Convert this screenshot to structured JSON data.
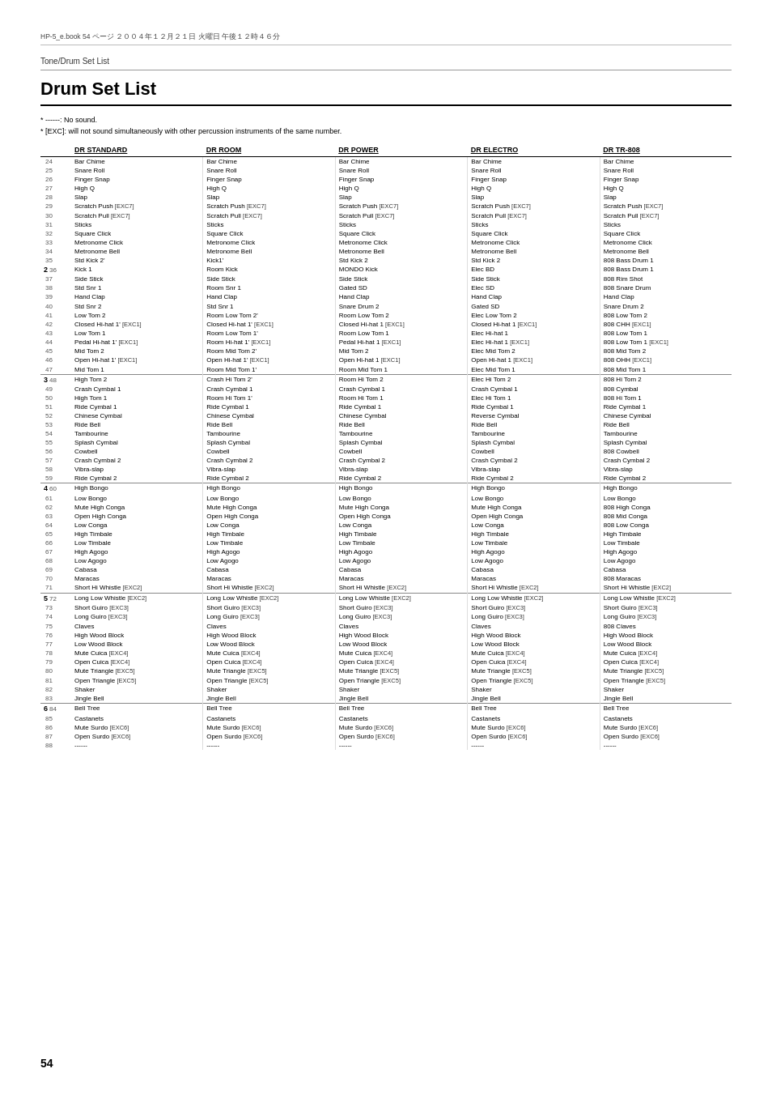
{
  "header": {
    "breadcrumb": "Tone/Drum Set List",
    "title": "Drum Set List",
    "page_info": "HP-5_e.book  54 ページ  ２００４年１２月２１日  火曜日  午後１２時４６分"
  },
  "notes": [
    "* ------: No sound.",
    "* [EXC]: will not sound simultaneously with other percussion instruments of the same number."
  ],
  "columns": [
    "DR STANDARD",
    "DR ROOM",
    "DR POWER",
    "DR ELECTRO",
    "DR TR-808"
  ],
  "page_number": "54",
  "groups": [
    {
      "group": "",
      "items": [
        {
          "num": "24",
          "group_num": "",
          "names": [
            "Bar Chime",
            "Bar Chime",
            "Bar Chime",
            "Bar Chime",
            "Bar Chime"
          ]
        },
        {
          "num": "25",
          "group_num": "",
          "names": [
            "Snare Roll",
            "Snare Roll",
            "Snare Roll",
            "Snare Roll",
            "Snare Roll"
          ]
        },
        {
          "num": "26",
          "group_num": "",
          "names": [
            "Finger Snap",
            "Finger Snap",
            "Finger Snap",
            "Finger Snap",
            "Finger Snap"
          ]
        },
        {
          "num": "27",
          "group_num": "",
          "names": [
            "High Q",
            "High Q",
            "High Q",
            "High Q",
            "High Q"
          ]
        },
        {
          "num": "28",
          "group_num": "",
          "names": [
            "Slap",
            "Slap",
            "Slap",
            "Slap",
            "Slap"
          ]
        },
        {
          "num": "29",
          "group_num": "",
          "names": [
            "Scratch Push [EXC7]",
            "Scratch Push [EXC7]",
            "Scratch Push [EXC7]",
            "Scratch Push [EXC7]",
            "Scratch Push [EXC7]"
          ]
        },
        {
          "num": "30",
          "group_num": "",
          "names": [
            "Scratch Pull [EXC7]",
            "Scratch Pull [EXC7]",
            "Scratch Pull [EXC7]",
            "Scratch Pull [EXC7]",
            "Scratch Pull [EXC7]"
          ]
        },
        {
          "num": "31",
          "group_num": "",
          "names": [
            "Sticks",
            "Sticks",
            "Sticks",
            "Sticks",
            "Sticks"
          ]
        },
        {
          "num": "32",
          "group_num": "",
          "names": [
            "Square Click",
            "Square Click",
            "Square Click",
            "Square Click",
            "Square Click"
          ]
        },
        {
          "num": "33",
          "group_num": "",
          "names": [
            "Metronome Click",
            "Metronome Click",
            "Metronome Click",
            "Metronome Click",
            "Metronome Click"
          ]
        },
        {
          "num": "34",
          "group_num": "",
          "names": [
            "Metronome Bell",
            "Metronome Bell",
            "Metronome Bell",
            "Metronome Bell",
            "Metronome Bell"
          ]
        },
        {
          "num": "35",
          "group_num": "",
          "names": [
            "Std Kick 2'",
            "Kick1'",
            "Std Kick 2",
            "Std Kick 2",
            "808 Bass Drum 1"
          ]
        },
        {
          "num": "36",
          "group_num": "2",
          "names": [
            "Kick 1",
            "Room Kick",
            "MONDO Kick",
            "Elec BD",
            "808 Bass Drum 1"
          ]
        },
        {
          "num": "37",
          "group_num": "",
          "names": [
            "Side Stick",
            "Side Stick",
            "Side Stick",
            "Side Stick",
            "808 Rim Shot"
          ]
        },
        {
          "num": "38",
          "group_num": "",
          "names": [
            "Std Snr 1",
            "Room Snr 1",
            "Gated SD",
            "Elec SD",
            "808 Snare Drum"
          ]
        },
        {
          "num": "39",
          "group_num": "",
          "names": [
            "Hand Clap",
            "Hand Clap",
            "Hand Clap",
            "Hand Clap",
            "Hand Clap"
          ]
        },
        {
          "num": "40",
          "group_num": "",
          "names": [
            "Std Snr 2",
            "Std Snr 1",
            "Snare Drum 2",
            "Gated SD",
            "Snare Drum 2"
          ]
        },
        {
          "num": "41",
          "group_num": "",
          "names": [
            "Low Tom 2",
            "Room Low Tom 2'",
            "Room Low Tom 2",
            "Elec Low Tom 2",
            "808 Low Tom 2"
          ]
        },
        {
          "num": "42",
          "group_num": "",
          "names": [
            "Closed Hi-hat 1' [EXC1]",
            "Closed Hi-hat 1' [EXC1]",
            "Closed Hi-hat 1 [EXC1]",
            "Closed Hi-hat 1 [EXC1]",
            "808 CHH [EXC1]"
          ]
        },
        {
          "num": "43",
          "group_num": "",
          "names": [
            "Low Tom 1",
            "Room Low Tom 1'",
            "Room Low Tom 1",
            "Elec Hi-hat 1",
            "808 Low Tom 1"
          ]
        },
        {
          "num": "44",
          "group_num": "",
          "names": [
            "Pedal Hi-hat 1' [EXC1]",
            "Room Hi-hat 1' [EXC1]",
            "Pedal Hi-hat 1 [EXC1]",
            "Elec Hi-hat 1 [EXC1]",
            "808 Low Tom 1 [EXC1]"
          ]
        },
        {
          "num": "45",
          "group_num": "",
          "names": [
            "Mid Tom 2",
            "Room Mid Tom 2'",
            "Mid Tom 2",
            "Elec Mid Tom 2",
            "808 Mid Tom 2"
          ]
        },
        {
          "num": "46",
          "group_num": "",
          "names": [
            "Open Hi-hat 1' [EXC1]",
            "Open Hi-hat 1' [EXC1]",
            "Open Hi-hat 1 [EXC1]",
            "Open Hi-hat 1 [EXC1]",
            "808 OHH [EXC1]"
          ]
        },
        {
          "num": "47",
          "group_num": "",
          "names": [
            "Mid Tom 1",
            "Room Mid Tom 1'",
            "Room Mid Tom 1",
            "Elec Mid Tom 1",
            "808 Mid Tom 1"
          ]
        }
      ]
    },
    {
      "group": "3",
      "items": [
        {
          "num": "48",
          "group_num": "3",
          "names": [
            "High Tom 2",
            "Crash Hi Tom 2'",
            "Room Hi Tom 2",
            "Elec Hi Tom 2",
            "808 Hi Tom 2"
          ]
        },
        {
          "num": "49",
          "group_num": "",
          "names": [
            "Crash Cymbal 1",
            "Crash Cymbal 1",
            "Crash Cymbal 1",
            "Crash Cymbal 1",
            "808 Cymbal"
          ]
        },
        {
          "num": "50",
          "group_num": "",
          "names": [
            "High Tom 1",
            "Room Hi Tom 1'",
            "Room Hi Tom 1",
            "Elec Hi Tom 1",
            "808 Hi Tom 1"
          ]
        },
        {
          "num": "51",
          "group_num": "",
          "names": [
            "Ride Cymbal 1",
            "Ride Cymbal 1",
            "Ride Cymbal 1",
            "Ride Cymbal 1",
            "Ride Cymbal 1"
          ]
        },
        {
          "num": "52",
          "group_num": "",
          "names": [
            "Chinese Cymbal",
            "Chinese Cymbal",
            "Chinese Cymbal",
            "Reverse Cymbal",
            "Chinese Cymbal"
          ]
        },
        {
          "num": "53",
          "group_num": "",
          "names": [
            "Ride Bell",
            "Ride Bell",
            "Ride Bell",
            "Ride Bell",
            "Ride Bell"
          ]
        },
        {
          "num": "54",
          "group_num": "",
          "names": [
            "Tambourine",
            "Tambourine",
            "Tambourine",
            "Tambourine",
            "Tambourine"
          ]
        },
        {
          "num": "55",
          "group_num": "",
          "names": [
            "Splash Cymbal",
            "Splash Cymbal",
            "Splash Cymbal",
            "Splash Cymbal",
            "Splash Cymbal"
          ]
        },
        {
          "num": "56",
          "group_num": "",
          "names": [
            "Cowbell",
            "Cowbell",
            "Cowbell",
            "Cowbell",
            "808 Cowbell"
          ]
        },
        {
          "num": "57",
          "group_num": "",
          "names": [
            "Crash Cymbal 2",
            "Crash Cymbal 2",
            "Crash Cymbal 2",
            "Crash Cymbal 2",
            "Crash Cymbal 2"
          ]
        },
        {
          "num": "58",
          "group_num": "",
          "names": [
            "Vibra-slap",
            "Vibra-slap",
            "Vibra-slap",
            "Vibra-slap",
            "Vibra-slap"
          ]
        },
        {
          "num": "59",
          "group_num": "",
          "names": [
            "Ride Cymbal 2",
            "Ride Cymbal 2",
            "Ride Cymbal 2",
            "Ride Cymbal 2",
            "Ride Cymbal 2"
          ]
        }
      ]
    },
    {
      "group": "4",
      "items": [
        {
          "num": "60",
          "group_num": "4",
          "names": [
            "High Bongo",
            "High Bongo",
            "High Bongo",
            "High Bongo",
            "High Bongo"
          ]
        },
        {
          "num": "61",
          "group_num": "",
          "names": [
            "Low Bongo",
            "Low Bongo",
            "Low Bongo",
            "Low Bongo",
            "Low Bongo"
          ]
        },
        {
          "num": "62",
          "group_num": "",
          "names": [
            "Mute High Conga",
            "Mute High Conga",
            "Mute High Conga",
            "Mute High Conga",
            "808 High Conga"
          ]
        },
        {
          "num": "63",
          "group_num": "",
          "names": [
            "Open High Conga",
            "Open High Conga",
            "Open High Conga",
            "Open High Conga",
            "808 Mid Conga"
          ]
        },
        {
          "num": "64",
          "group_num": "",
          "names": [
            "Low Conga",
            "Low Conga",
            "Low Conga",
            "Low Conga",
            "808 Low Conga"
          ]
        },
        {
          "num": "65",
          "group_num": "",
          "names": [
            "High Timbale",
            "High Timbale",
            "High Timbale",
            "High Timbale",
            "High Timbale"
          ]
        },
        {
          "num": "66",
          "group_num": "",
          "names": [
            "Low Timbale",
            "Low Timbale",
            "Low Timbale",
            "Low Timbale",
            "Low Timbale"
          ]
        },
        {
          "num": "67",
          "group_num": "",
          "names": [
            "High Agogo",
            "High Agogo",
            "High Agogo",
            "High Agogo",
            "High Agogo"
          ]
        },
        {
          "num": "68",
          "group_num": "",
          "names": [
            "Low Agogo",
            "Low Agogo",
            "Low Agogo",
            "Low Agogo",
            "Low Agogo"
          ]
        },
        {
          "num": "69",
          "group_num": "",
          "names": [
            "Cabasa",
            "Cabasa",
            "Cabasa",
            "Cabasa",
            "Cabasa"
          ]
        },
        {
          "num": "70",
          "group_num": "",
          "names": [
            "Maracas",
            "Maracas",
            "Maracas",
            "Maracas",
            "808 Maracas"
          ]
        },
        {
          "num": "71",
          "group_num": "",
          "names": [
            "Short Hi Whistle [EXC2]",
            "Short Hi Whistle [EXC2]",
            "Short Hi Whistle [EXC2]",
            "Short Hi Whistle [EXC2]",
            "Short Hi Whistle [EXC2]"
          ]
        }
      ]
    },
    {
      "group": "5",
      "items": [
        {
          "num": "72",
          "group_num": "5",
          "names": [
            "Long Low Whistle [EXC2]",
            "Long Low Whistle [EXC2]",
            "Long Low Whistle [EXC2]",
            "Long Low Whistle [EXC2]",
            "Long Low Whistle [EXC2]"
          ]
        },
        {
          "num": "73",
          "group_num": "",
          "names": [
            "Short Guiro [EXC3]",
            "Short Guiro [EXC3]",
            "Short Guiro [EXC3]",
            "Short Guiro [EXC3]",
            "Short Guiro [EXC3]"
          ]
        },
        {
          "num": "74",
          "group_num": "",
          "names": [
            "Long Guiro [EXC3]",
            "Long Guiro [EXC3]",
            "Long Guiro [EXC3]",
            "Long Guiro [EXC3]",
            "Long Guiro [EXC3]"
          ]
        },
        {
          "num": "75",
          "group_num": "",
          "names": [
            "Claves",
            "Claves",
            "Claves",
            "Claves",
            "808 Claves"
          ]
        },
        {
          "num": "76",
          "group_num": "",
          "names": [
            "High Wood Block",
            "High Wood Block",
            "High Wood Block",
            "High Wood Block",
            "High Wood Block"
          ]
        },
        {
          "num": "77",
          "group_num": "",
          "names": [
            "Low Wood Block",
            "Low Wood Block",
            "Low Wood Block",
            "Low Wood Block",
            "Low Wood Block"
          ]
        },
        {
          "num": "78",
          "group_num": "",
          "names": [
            "Mute Cuica [EXC4]",
            "Mute Cuica [EXC4]",
            "Mute Cuica [EXC4]",
            "Mute Cuica [EXC4]",
            "Mute Cuica [EXC4]"
          ]
        },
        {
          "num": "79",
          "group_num": "",
          "names": [
            "Open Cuica [EXC4]",
            "Open Cuica [EXC4]",
            "Open Cuica [EXC4]",
            "Open Cuica [EXC4]",
            "Open Cuica [EXC4]"
          ]
        },
        {
          "num": "80",
          "group_num": "",
          "names": [
            "Mute Triangle [EXC5]",
            "Mute Triangle [EXC5]",
            "Mute Triangle [EXC5]",
            "Mute Triangle [EXC5]",
            "Mute Triangle [EXC5]"
          ]
        },
        {
          "num": "81",
          "group_num": "",
          "names": [
            "Open Triangle [EXC5]",
            "Open Triangle [EXC5]",
            "Open Triangle [EXC5]",
            "Open Triangle [EXC5]",
            "Open Triangle [EXC5]"
          ]
        },
        {
          "num": "82",
          "group_num": "",
          "names": [
            "Shaker",
            "Shaker",
            "Shaker",
            "Shaker",
            "Shaker"
          ]
        },
        {
          "num": "83",
          "group_num": "",
          "names": [
            "Jingle Bell",
            "Jingle Bell",
            "Jingle Bell",
            "Jingle Bell",
            "Jingle Bell"
          ]
        }
      ]
    },
    {
      "group": "6",
      "items": [
        {
          "num": "84",
          "group_num": "6",
          "names": [
            "Bell Tree",
            "Bell Tree",
            "Bell Tree",
            "Bell Tree",
            "Bell Tree"
          ]
        },
        {
          "num": "85",
          "group_num": "",
          "names": [
            "Castanets",
            "Castanets",
            "Castanets",
            "Castanets",
            "Castanets"
          ]
        },
        {
          "num": "86",
          "group_num": "",
          "names": [
            "Mute Surdo [EXC6]",
            "Mute Surdo [EXC6]",
            "Mute Surdo [EXC6]",
            "Mute Surdo [EXC6]",
            "Mute Surdo [EXC6]"
          ]
        },
        {
          "num": "87",
          "group_num": "",
          "names": [
            "Open Surdo [EXC6]",
            "Open Surdo [EXC6]",
            "Open Surdo [EXC6]",
            "Open Surdo [EXC6]",
            "Open Surdo [EXC6]"
          ]
        },
        {
          "num": "88",
          "group_num": "",
          "names": [
            "------",
            "------",
            "------",
            "------",
            "------"
          ]
        }
      ]
    }
  ]
}
